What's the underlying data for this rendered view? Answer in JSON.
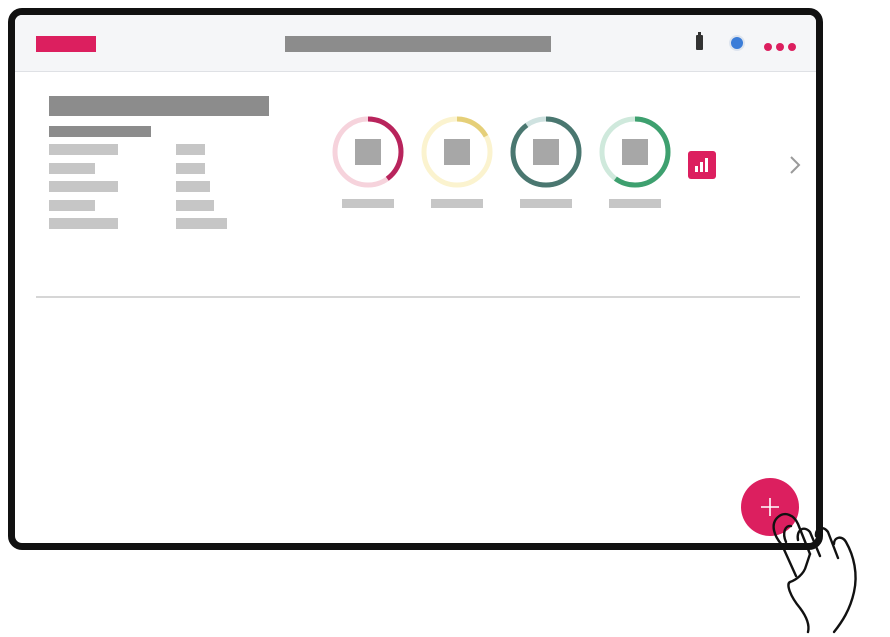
{
  "colors": {
    "accent": "#dc1f5f",
    "frame": "#111111",
    "skeleton_dark": "#8c8c8c",
    "skeleton_light": "#c6c6c6",
    "status_dot": "#3b7dd8"
  },
  "header": {
    "brand_logo": "brand-logo-placeholder",
    "title_placeholder": "title-placeholder",
    "icons": [
      "battery-icon",
      "status-dot-icon",
      "more-options-icon"
    ]
  },
  "summary": {
    "info_rows": 5,
    "rings": [
      {
        "name": "ring-1",
        "track": "#f6d3dc",
        "progress_color": "#b8245c",
        "progress": 0.4
      },
      {
        "name": "ring-2",
        "track": "#fbf3cf",
        "progress_color": "#e5cf78",
        "progress": 0.17
      },
      {
        "name": "ring-3",
        "track": "#cfe2e0",
        "progress_color": "#4a7770",
        "progress": 0.9
      },
      {
        "name": "ring-4",
        "track": "#cfe9dc",
        "progress_color": "#3ea06f",
        "progress": 0.6
      }
    ],
    "chart_button_icon": "bar-chart-icon",
    "next_icon": "chevron-right-icon"
  },
  "fab": {
    "icon": "plus-icon"
  },
  "gesture": {
    "icon": "tapping-hand-icon"
  }
}
